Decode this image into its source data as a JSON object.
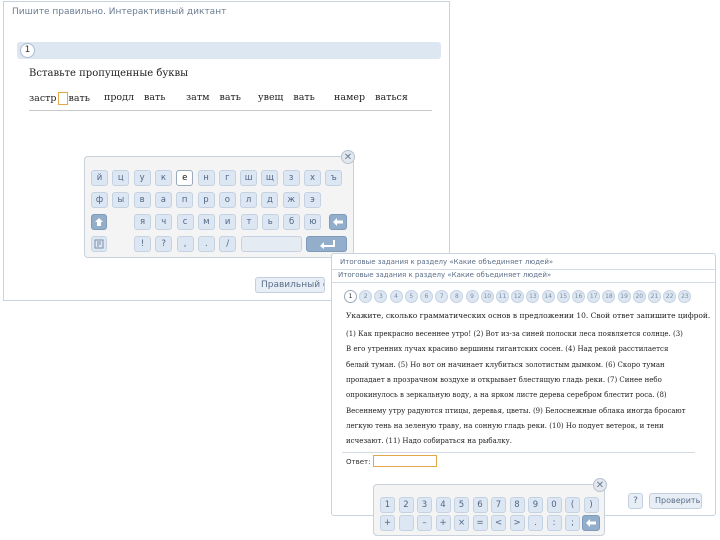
{
  "window1": {
    "title": "Пишите правильно. Интерактивный диктант",
    "question_number": "1",
    "instruction": "Вставьте пропущенные буквы",
    "words": [
      {
        "before": "застр",
        "after": "вать"
      },
      {
        "before": "продл",
        "after": "вать"
      },
      {
        "before": "затм",
        "after": "вать"
      },
      {
        "before": "увещ",
        "after": "вать"
      },
      {
        "before": "намер",
        "after": "ваться"
      }
    ],
    "check_button": "Правильный ответ"
  },
  "keyboard1": {
    "close_icon": "✕",
    "row1": [
      "й",
      "ц",
      "у",
      "к",
      "е",
      "н",
      "г",
      "ш",
      "щ",
      "з",
      "х",
      "ъ"
    ],
    "row2": [
      "ф",
      "ы",
      "в",
      "а",
      "п",
      "р",
      "о",
      "л",
      "д",
      "ж",
      "э"
    ],
    "row3": [
      "я",
      "ч",
      "с",
      "м",
      "и",
      "т",
      "ь",
      "б",
      "ю"
    ],
    "row4": [
      "!",
      "?",
      ",",
      ".",
      "/"
    ],
    "selected_key": "е",
    "shift_icon": "shift-arrow-icon",
    "backspace_icon": "backspace-arrow-icon",
    "enter_icon": "enter-return-icon",
    "lang_icon": "layout-switch-icon"
  },
  "window2": {
    "title": "Итоговые задания к разделу «Как­ие объединяет людей»",
    "subtitle": "Итоговые задания к разделу «Как­ие объединяет людей»",
    "tabs": [
      "1",
      "2",
      "3",
      "4",
      "5",
      "6",
      "7",
      "8",
      "9",
      "10",
      "11",
      "12",
      "13",
      "14",
      "15",
      "16",
      "17",
      "18",
      "19",
      "20",
      "21",
      "22",
      "23"
    ],
    "active_tab": "1",
    "question": "Укажите, сколько грамматических основ в предложении 10. Свой ответ запишите цифрой.",
    "passage": [
      "(1) Как прекрасно весеннее утро! (2) Вот из-за синей полоски леса появляется солнце. (3)",
      "В его утренних лучах красиво вершины гигантских сосен. (4) Над рекой расстилается",
      "белый туман. (5) Но вот он начинает клубиться золотистым дымком. (6) Скоро туман",
      "пропадает в прозрачном воздухе и открывает блестящую гладь реки. (7) Синее небо",
      "опрокинулось в зеркальную воду, а на ярком листе дерева серебром блестит роса. (8)",
      "Весеннему утру радуются птицы, деревья, цветы. (9) Белоснежные облака иногда бросают",
      "легкую тень на зеленую траву, на сонную гладь реки. (10) Но подует ветерок, и тени",
      "исчезают. (11) Надо собираться на рыбалку."
    ],
    "answer_label": "Ответ:",
    "answer_value": "",
    "help_button": "?",
    "check_button": "Проверить"
  },
  "keyboard2": {
    "close_icon": "✕",
    "row1": [
      "1",
      "2",
      "3",
      "4",
      "5",
      "6",
      "7",
      "8",
      "9",
      "0",
      "(",
      ")"
    ],
    "row2": [
      "+",
      "",
      "–",
      "+",
      "×",
      "=",
      "<",
      ">",
      ".",
      ":",
      ";"
    ],
    "backspace_icon": "backspace-arrow-icon"
  },
  "colors": {
    "accent": "#93aecb",
    "key_bg": "#dde7f3",
    "answer_border": "#e3a84b"
  }
}
